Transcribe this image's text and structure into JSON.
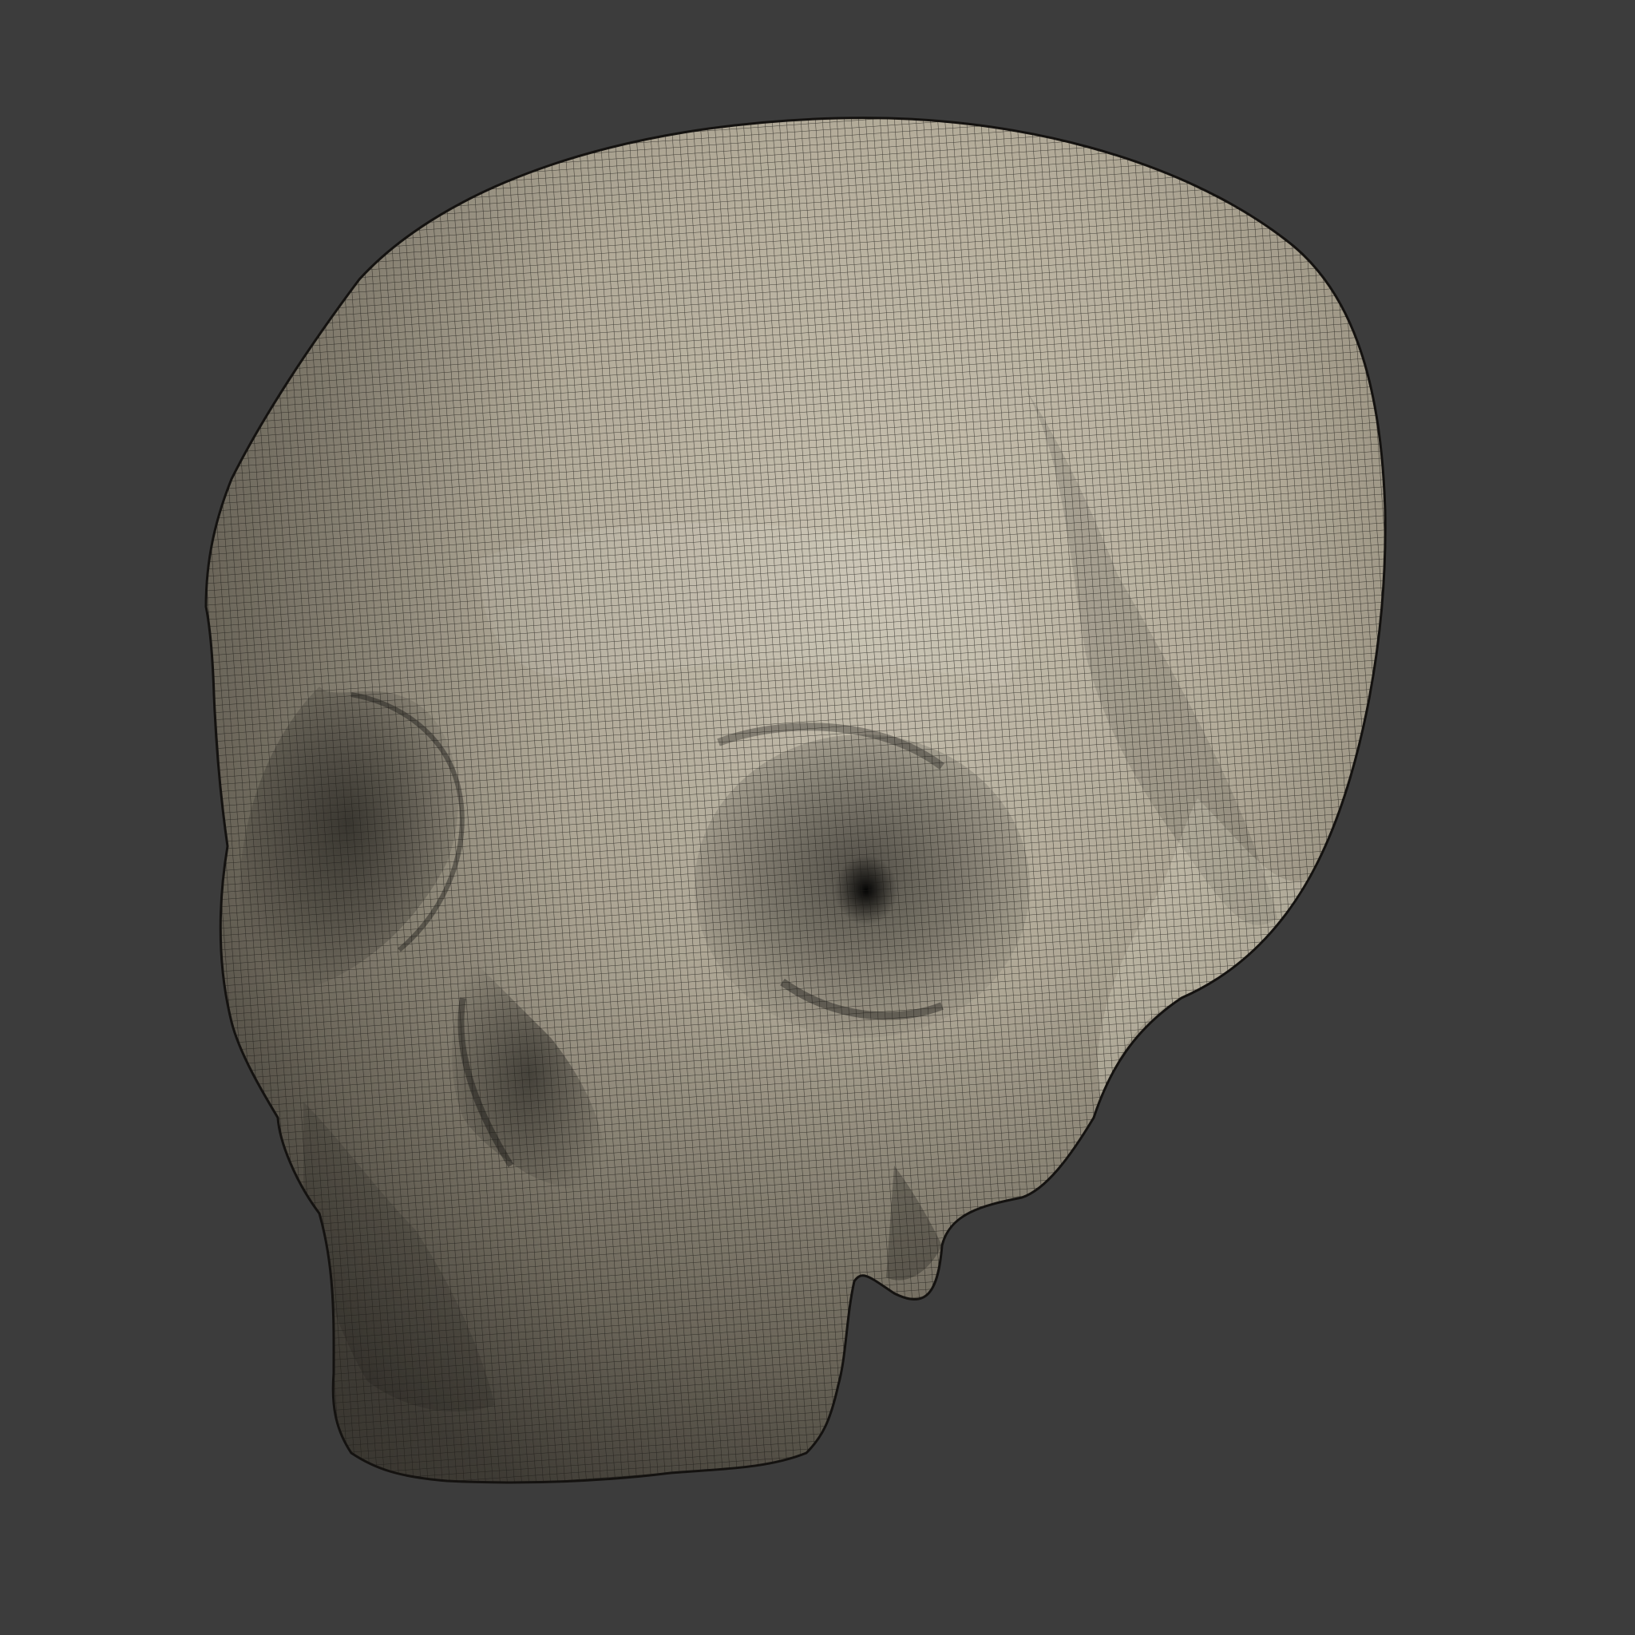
{
  "viewport": {
    "background_color": "#3c3c3c",
    "model": {
      "subject": "skull",
      "display_mode": "shaded-wireframe",
      "surface_color": "#c8c0ad",
      "wire_color": "#1c1a16"
    }
  }
}
